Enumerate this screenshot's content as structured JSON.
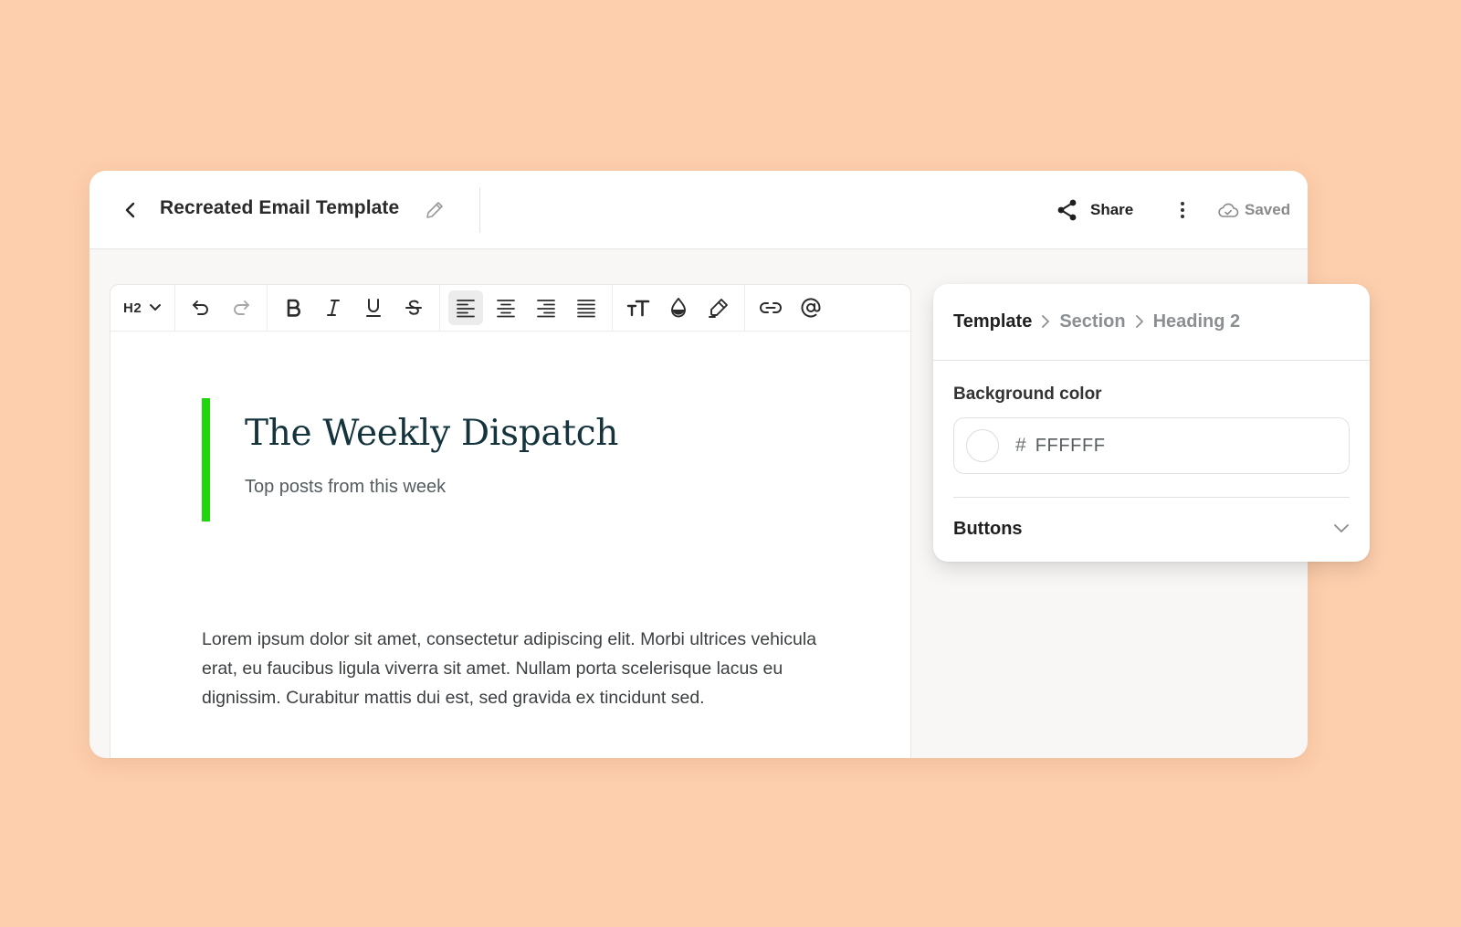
{
  "header": {
    "title": "Recreated Email Template",
    "share_label": "Share",
    "saved_label": "Saved"
  },
  "toolbar": {
    "heading_select_value": "H2",
    "tools": [
      "undo-icon",
      "redo-icon",
      "bold-icon",
      "italic-icon",
      "underline-icon",
      "strikethrough-icon",
      "align-left-icon",
      "align-center-icon",
      "align-right-icon",
      "align-justify-icon",
      "text-size-icon",
      "text-color-icon",
      "highlighter-icon",
      "link-icon",
      "mention-icon"
    ],
    "active_tool": "align-left-icon"
  },
  "content": {
    "heading": "The Weekly Dispatch",
    "subheading": "Top posts from this week",
    "paragraph": "Lorem ipsum dolor sit amet, consectetur adipiscing elit. Morbi ultrices vehicula erat, eu faucibus ligula viverra sit amet. Nullam porta scelerisque lacus eu dignissim. Curabitur mattis dui est, sed gravida ex tincidunt sed.",
    "accent_color": "#1FD50C"
  },
  "panel": {
    "breadcrumb": [
      "Template",
      "Section",
      "Heading 2"
    ],
    "background_color_label": "Background color",
    "hash": "#",
    "background_color_value": "FFFFFF",
    "buttons_label": "Buttons"
  },
  "colors": {
    "page_background": "#FECFAD",
    "heading_text": "#14333C",
    "accent_bar": "#1FD50C"
  }
}
